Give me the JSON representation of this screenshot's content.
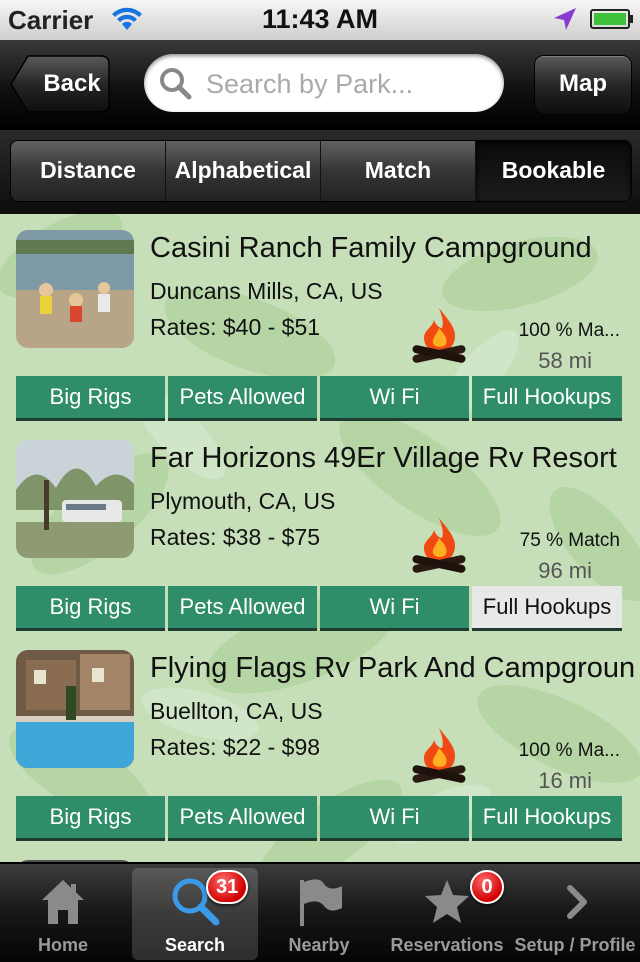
{
  "status_bar": {
    "carrier": "Carrier",
    "time": "11:43 AM"
  },
  "nav": {
    "back_label": "Back",
    "search_placeholder": "Search by Park...",
    "map_label": "Map"
  },
  "sort_tabs": [
    {
      "label": "Distance"
    },
    {
      "label": "Alphabetical"
    },
    {
      "label": "Match"
    },
    {
      "label": "Bookable",
      "selected": true
    }
  ],
  "parks": [
    {
      "name": "Casini Ranch Family Campground",
      "location": "Duncans Mills, CA, US",
      "rates": "Rates: $40 - $51",
      "match": "100 % Ma...",
      "distance": "58 mi",
      "features": [
        {
          "label": "Big Rigs",
          "on": true
        },
        {
          "label": "Pets Allowed",
          "on": true
        },
        {
          "label": "Wi Fi",
          "on": true
        },
        {
          "label": "Full Hookups",
          "on": true
        }
      ]
    },
    {
      "name": "Far Horizons 49Er Village Rv Resort",
      "location": "Plymouth, CA, US",
      "rates": "Rates: $38 - $75",
      "match": "75 % Match",
      "distance": "96 mi",
      "features": [
        {
          "label": "Big Rigs",
          "on": true
        },
        {
          "label": "Pets Allowed",
          "on": true
        },
        {
          "label": "Wi Fi",
          "on": true
        },
        {
          "label": "Full Hookups",
          "on": false
        }
      ]
    },
    {
      "name": "Flying Flags Rv Park And Campground",
      "location": "Buellton, CA, US",
      "rates": "Rates: $22 - $98",
      "match": "100 % Ma...",
      "distance": "16 mi",
      "features": [
        {
          "label": "Big Rigs",
          "on": true
        },
        {
          "label": "Pets Allowed",
          "on": true
        },
        {
          "label": "Wi Fi",
          "on": true
        },
        {
          "label": "Full Hookups",
          "on": true
        }
      ]
    }
  ],
  "tab_bar": [
    {
      "label": "Home",
      "icon": "home-icon"
    },
    {
      "label": "Search",
      "icon": "search-icon",
      "badge": "31",
      "selected": true
    },
    {
      "label": "Nearby",
      "icon": "flag-icon"
    },
    {
      "label": "Reservations",
      "icon": "star-icon",
      "badge": "0"
    },
    {
      "label": "Setup / Profile",
      "icon": "chevron-right-icon"
    }
  ],
  "colors": {
    "feature_on": "#2f8d6a",
    "feature_off": "#e8e8e8",
    "badge": "#d10000",
    "content_bg": "#c6dfb8"
  }
}
